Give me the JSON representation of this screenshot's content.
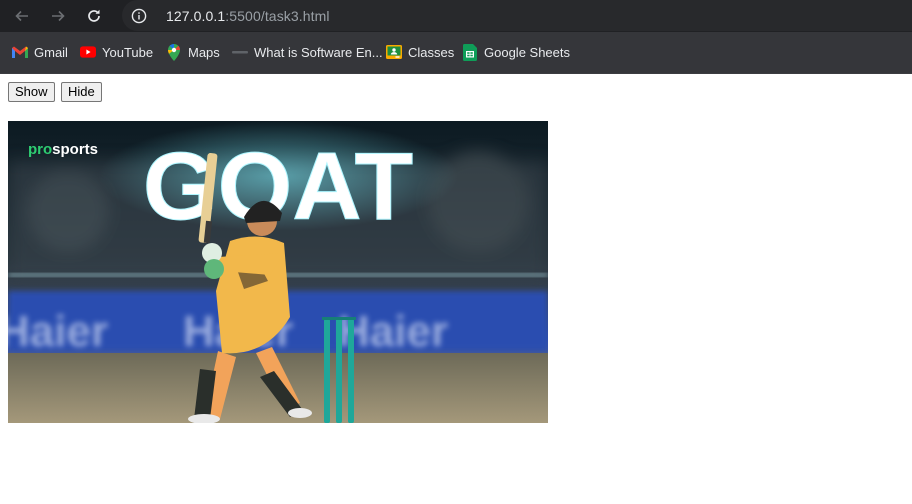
{
  "browser": {
    "url_host": "127.0.0.1",
    "url_rest": ":5500/task3.html"
  },
  "bookmarks": [
    {
      "label": "Gmail",
      "icon": "gmail-icon"
    },
    {
      "label": "YouTube",
      "icon": "youtube-icon"
    },
    {
      "label": "Maps",
      "icon": "maps-icon"
    },
    {
      "label": "What is Software En...",
      "icon": "bookmark-icon"
    },
    {
      "label": "Classes",
      "icon": "classes-icon"
    },
    {
      "label": "Google Sheets",
      "icon": "sheets-icon"
    }
  ],
  "page": {
    "show_label": "Show",
    "hide_label": "Hide"
  },
  "image": {
    "brand_pro": "pro",
    "brand_sports": "sports",
    "headline": "GOAT",
    "sponsor": "Haier"
  },
  "colors": {
    "chrome_dark": "#202124",
    "bookmark_bar": "#35363a",
    "jersey_yellow": "#f2b84b",
    "stumps_teal": "#1fa79a",
    "glow_cyan": "#7ff3ff"
  }
}
